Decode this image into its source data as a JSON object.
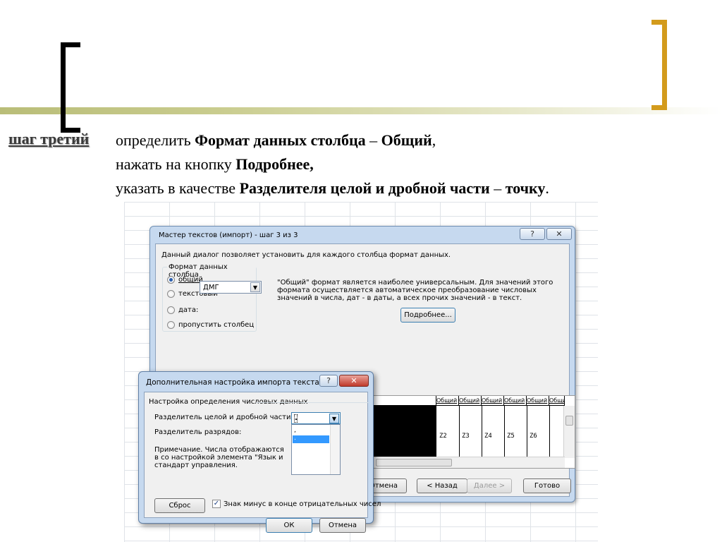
{
  "slide": {
    "step_label": "шаг третий",
    "line1": {
      "pre": "определить ",
      "b1": "Формат данных столбца",
      "mid": " – ",
      "b2": "Общий",
      "post": ","
    },
    "line2": {
      "pre": "нажать на кнопку ",
      "b1": "Подробнее,"
    },
    "line3": {
      "pre": "указать в качестве ",
      "b1": "Разделителя целой и дробной части",
      "mid": " – ",
      "b2": "точку",
      "post": "."
    }
  },
  "wizard": {
    "title": "Мастер текстов (импорт) - шаг 3 из 3",
    "help_icon": "?",
    "close_icon": "✕",
    "intro": "Данный диалог позволяет установить для каждого столбца формат данных.",
    "group_label": "Формат данных столбца",
    "radio_general": "общий",
    "radio_text": "текстовый",
    "radio_date": "дата:",
    "date_format": "ДМГ",
    "radio_skip": "пропустить столбец",
    "description": "\"Общий\" формат является наиболее универсальным. Для значений этого формата осуществляется автоматическое преобразование числовых значений в числа, дат - в даты, а всех прочих значений - в текст.",
    "more_button": "Подробнее...",
    "preview_headers": [
      "Общий",
      "Общий",
      "Общий",
      "Общий",
      "Общий",
      "Общий"
    ],
    "preview_values": [
      "Z2",
      "Z3",
      "Z4",
      "Z5",
      "Z6"
    ],
    "cancel_button": "Отмена",
    "back_button": "< Назад",
    "next_button": "Далее >",
    "finish_button": "Готово"
  },
  "advanced": {
    "title": "Дополнительная настройка импорта текста",
    "help_icon": "?",
    "close_icon": "✕",
    "group_label": "Настройка определения числовых данных",
    "decimal_label": "Разделитель целой и дробной части:",
    "decimal_value": ".",
    "thousands_label": "Разделитель разрядов:",
    "options": [
      ",",
      "."
    ],
    "note": "Примечание. Числа отображаются в со настройкой элемента \"Язык и стандарт управления.",
    "reset_button": "Сброс",
    "minus_check_label": "Знак минус в конце отрицательных чисел",
    "minus_checked": true,
    "ok_button": "ОК",
    "cancel_button": "Отмена"
  }
}
